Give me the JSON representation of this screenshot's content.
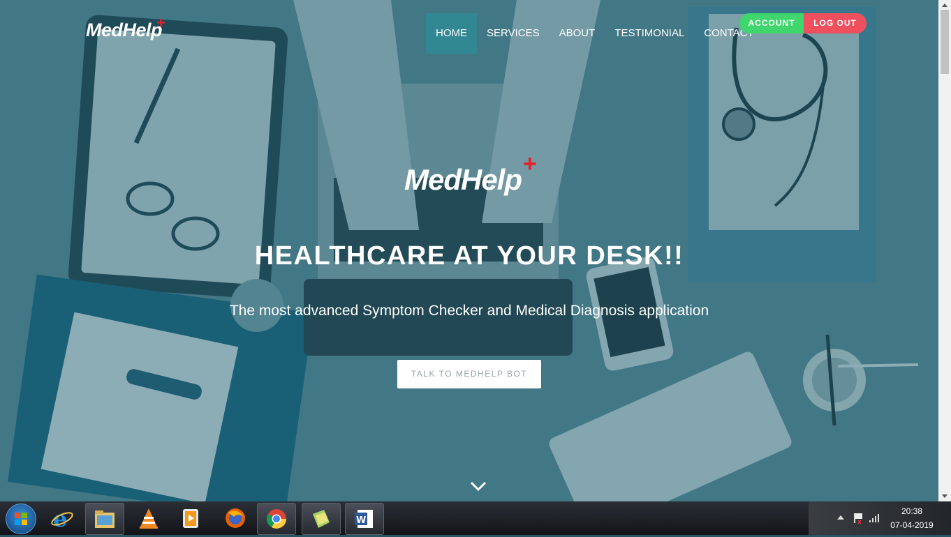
{
  "brand": {
    "name": "MedHelp",
    "plus": "+"
  },
  "nav": {
    "items": [
      {
        "label": "HOME",
        "active": true
      },
      {
        "label": "SERVICES",
        "active": false
      },
      {
        "label": "ABOUT",
        "active": false
      },
      {
        "label": "TESTIMONIAL",
        "active": false
      },
      {
        "label": "CONTACT",
        "active": false
      }
    ],
    "account_label": "ACCOUNT",
    "logout_label": "LOG OUT"
  },
  "hero": {
    "logo": "MedHelp",
    "plus": "+",
    "headline": "HEALTHCARE AT YOUR DESK!!",
    "subtitle": "The most advanced Symptom Checker and Medical Diagnosis application",
    "cta_label": "TALK TO MEDHELP BOT",
    "scroll_icon": "chevron-down-icon"
  },
  "taskbar": {
    "apps": [
      "windows-start-icon",
      "internet-explorer-icon",
      "file-explorer-icon",
      "vlc-icon",
      "media-player-icon",
      "firefox-icon",
      "chrome-icon",
      "folder-app-icon",
      "word-icon"
    ],
    "time": "20:38",
    "date": "07-04-2019"
  },
  "colors": {
    "account": "#3fd66d",
    "logout": "#f0505e",
    "overlay": "#2e6474",
    "plus": "#e3212b"
  }
}
